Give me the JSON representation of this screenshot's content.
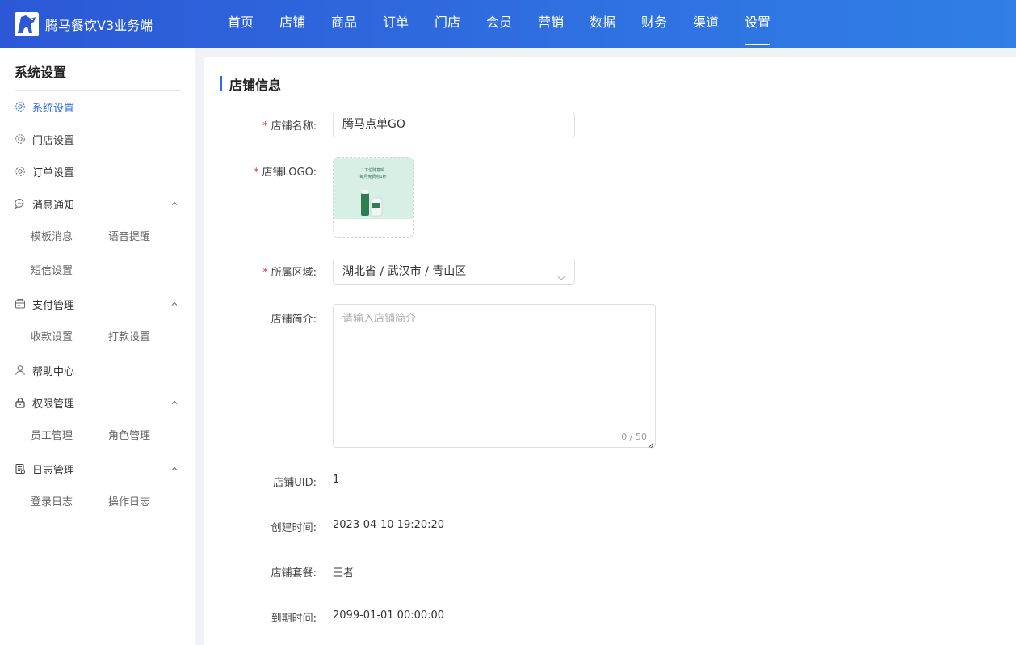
{
  "header": {
    "brand_name": "腾马餐饮V3业务端",
    "nav": [
      "首页",
      "店铺",
      "商品",
      "订单",
      "门店",
      "会员",
      "营销",
      "数据",
      "财务",
      "渠道",
      "设置"
    ],
    "active_nav": "设置"
  },
  "sidebar": {
    "title": "系统设置",
    "items": [
      {
        "label": "系统设置",
        "icon": "gear-icon",
        "active": true
      },
      {
        "label": "门店设置",
        "icon": "gear-icon"
      },
      {
        "label": "订单设置",
        "icon": "gear-icon"
      },
      {
        "label": "消息通知",
        "icon": "chat-bubble-icon",
        "expanded": true,
        "children": [
          "模板消息",
          "语音提醒",
          "短信设置"
        ]
      },
      {
        "label": "支付管理",
        "icon": "wallet-icon",
        "expanded": true,
        "children": [
          "收款设置",
          "打款设置"
        ]
      },
      {
        "label": "帮助中心",
        "icon": "user-icon"
      },
      {
        "label": "权限管理",
        "icon": "lock-icon",
        "expanded": true,
        "children": [
          "员工管理",
          "角色管理"
        ]
      },
      {
        "label": "日志管理",
        "icon": "document-icon",
        "expanded": true,
        "children": [
          "登录日志",
          "操作日志"
        ]
      }
    ]
  },
  "form": {
    "section_title": "店铺信息",
    "store_name_label": "店铺名称:",
    "store_name_value": "腾马点单GO",
    "logo_label": "店铺LOGO:",
    "logo_text_line1": "1下位随意喝",
    "logo_text_line2": "每月免费点1杯",
    "region_label": "所属区域:",
    "region_value": "湖北省 / 武汉市 / 青山区",
    "intro_label": "店铺简介:",
    "intro_placeholder": "请输入店铺简介",
    "intro_counter": "0 / 50",
    "uid_label": "店铺UID:",
    "uid_value": "1",
    "created_label": "创建时间:",
    "created_value": "2023-04-10 19:20:20",
    "package_label": "店铺套餐:",
    "package_value": "王者",
    "expire_label": "到期时间:",
    "expire_value": "2099-01-01 00:00:00"
  },
  "colors": {
    "header_gradient_start": "#2c58d6",
    "header_gradient_end": "#2f7fe6",
    "accent": "#2c6ee0",
    "required": "#e4393c"
  }
}
